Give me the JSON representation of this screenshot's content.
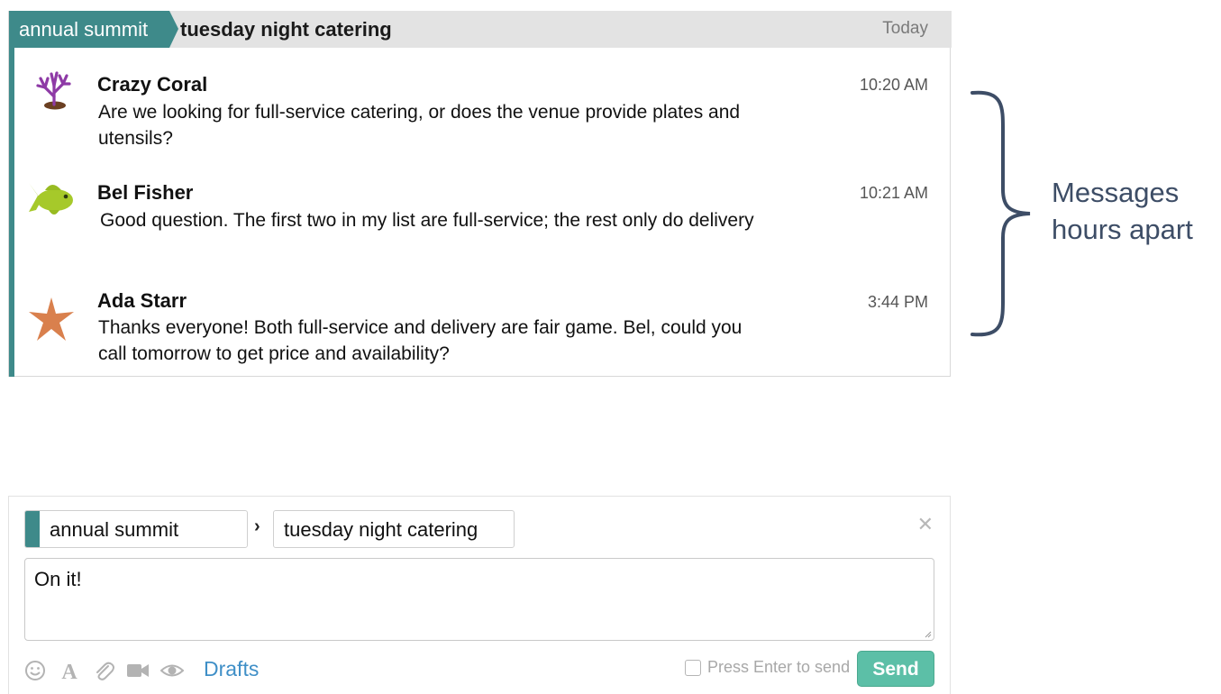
{
  "thread": {
    "stream": "annual summit",
    "topic": "tuesday night catering",
    "date": "Today",
    "messages": [
      {
        "sender": "Crazy Coral",
        "time": "10:20 AM",
        "content": "Are we looking for full-service catering, or does the venue provide plates and utensils?",
        "avatar": "coral-icon"
      },
      {
        "sender": "Bel Fisher",
        "time": "10:21 AM",
        "content": "Good question. The first two in my list are full-service; the rest only do delivery",
        "avatar": "fish-icon"
      },
      {
        "sender": "Ada Starr",
        "time": "3:44 PM",
        "content": "Thanks everyone! Both full-service and delivery are fair game. Bel, could you call tomorrow to get price and availability?",
        "avatar": "starfish-icon"
      }
    ]
  },
  "annotation": {
    "line1": "Messages",
    "line2": "hours apart"
  },
  "compose": {
    "stream_value": "annual summit",
    "topic_value": "tuesday night catering",
    "message_value": "On it!",
    "drafts_label": "Drafts",
    "enter_to_send_label": "Press Enter to send",
    "enter_to_send_checked": false,
    "send_label": "Send",
    "toolbar_icons": [
      "emoji-icon",
      "format-icon",
      "attachment-icon",
      "video-icon",
      "preview-icon"
    ]
  },
  "colors": {
    "stream": "#3e8a8a",
    "send_button": "#5cbfa7",
    "drafts_link": "#3f8fc7",
    "annotation": "#3d4d66"
  }
}
